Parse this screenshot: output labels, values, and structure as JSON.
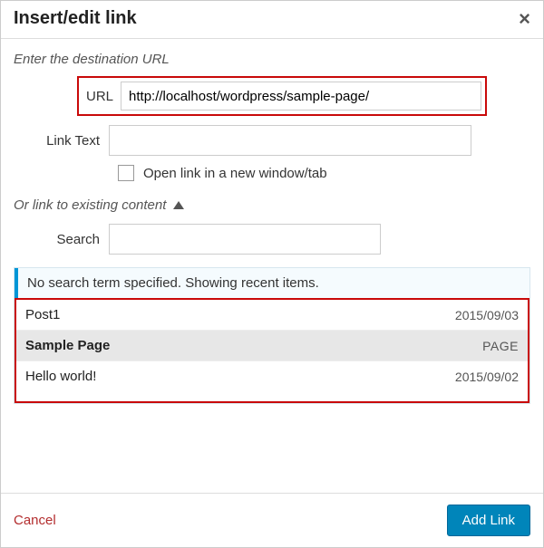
{
  "dialog": {
    "title": "Insert/edit link",
    "close_glyph": "×"
  },
  "destination": {
    "section_label": "Enter the destination URL",
    "url_label": "URL",
    "url_value": "http://localhost/wordpress/sample-page/",
    "linktext_label": "Link Text",
    "linktext_value": "",
    "newtab_label": "Open link in a new window/tab"
  },
  "existing": {
    "section_label": "Or link to existing content",
    "search_label": "Search",
    "search_value": "",
    "info": "No search term specified. Showing recent items.",
    "items": [
      {
        "title": "Post1",
        "meta": "2015/09/03",
        "selected": false
      },
      {
        "title": "Sample Page",
        "meta": "PAGE",
        "selected": true
      },
      {
        "title": "Hello world!",
        "meta": "2015/09/02",
        "selected": false
      }
    ]
  },
  "footer": {
    "cancel": "Cancel",
    "submit": "Add Link"
  }
}
